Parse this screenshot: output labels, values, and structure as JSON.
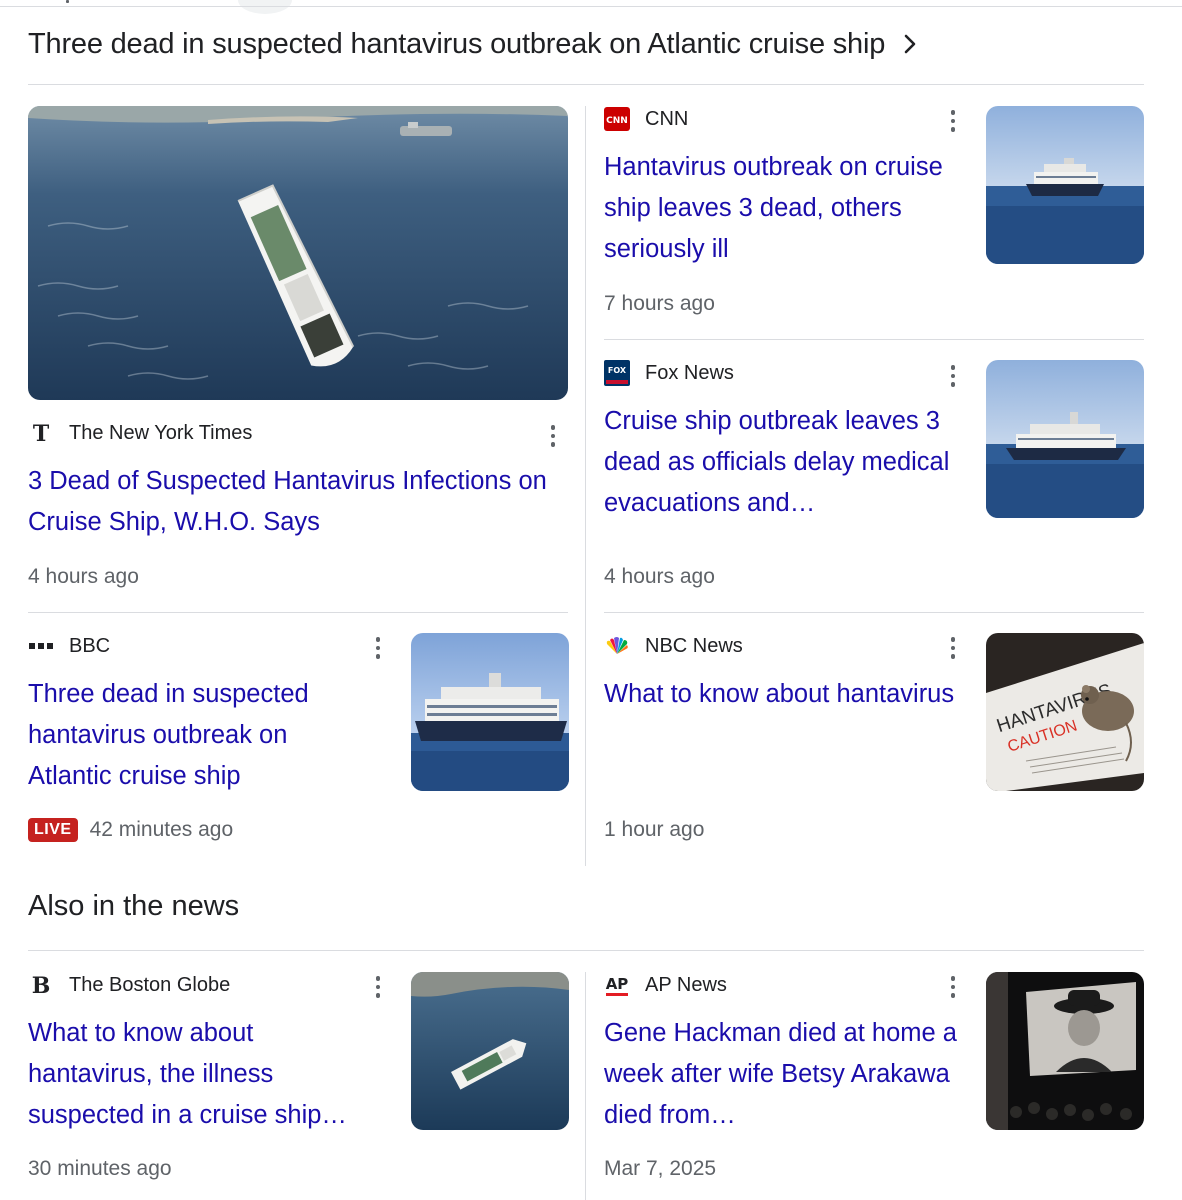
{
  "header": {
    "title": "Three dead in suspected hantavirus outbreak on Atlantic cruise ship"
  },
  "stories": [
    {
      "source": "The New York Times",
      "logo": "nyt-logo",
      "title": "3 Dead of Suspected Hantavirus Infections on Cruise Ship, W.H.O. Says",
      "time": "4 hours ago"
    },
    {
      "source": "CNN",
      "logo": "cnn-logo",
      "title": "Hantavirus outbreak on cruise ship leaves 3 dead, others seriously ill",
      "time": "7 hours ago"
    },
    {
      "source": "Fox News",
      "logo": "fox-news-logo",
      "title": "Cruise ship outbreak leaves 3 dead as officials delay medical evacuations and…",
      "time": "4 hours ago"
    },
    {
      "source": "BBC",
      "logo": "bbc-logo",
      "title": "Three dead in suspected hantavirus outbreak on Atlantic cruise ship",
      "badge": "LIVE",
      "time": "42 minutes ago"
    },
    {
      "source": "NBC News",
      "logo": "nbc-logo",
      "title": "What to know about hantavirus",
      "time": "1 hour ago"
    }
  ],
  "also": {
    "title": "Also in the news",
    "stories": [
      {
        "source": "The Boston Globe",
        "logo": "boston-globe-logo",
        "title": "What to know about hantavirus, the illness suspected in a cruise ship…",
        "time": "30 minutes ago"
      },
      {
        "source": "AP News",
        "logo": "ap-news-logo",
        "title": "Gene Hackman died at home a week after wife Betsy Arakawa died from…",
        "time": "Mar 7, 2025"
      }
    ]
  },
  "thumb_text": {
    "hantavirus_sign": "HANTAVIRUS",
    "caution": "CAUTION"
  },
  "colors": {
    "link": "#1a0dab",
    "text": "#202124",
    "meta": "#5f6368",
    "divider": "#dadce0",
    "live": "#c5221f"
  }
}
